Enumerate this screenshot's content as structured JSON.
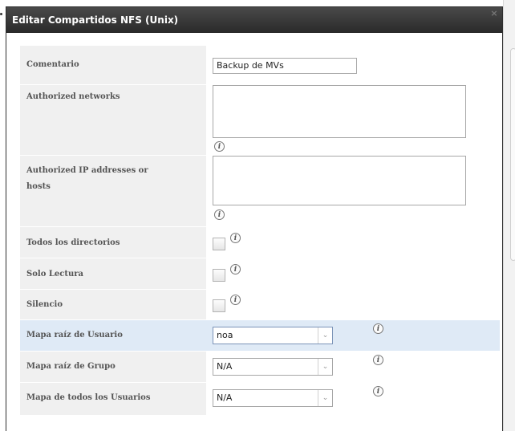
{
  "dialog": {
    "title": "Editar Compartidos NFS (Unix)",
    "close_glyph": "×"
  },
  "form": {
    "comment": {
      "label": "Comentario",
      "value": "Backup de MVs"
    },
    "authorized_networks": {
      "label": "Authorized networks",
      "value": ""
    },
    "authorized_hosts": {
      "label_line1": "Authorized IP addresses or",
      "label_line2": "hosts",
      "value": ""
    },
    "all_dirs": {
      "label": "Todos los directorios",
      "checked": false
    },
    "read_only": {
      "label": "Solo Lectura",
      "checked": false
    },
    "quiet": {
      "label": "Silencio",
      "checked": false
    },
    "maproot_user": {
      "label": "Mapa raíz de Usuario",
      "value": "noa"
    },
    "maproot_group": {
      "label": "Mapa raíz de Grupo",
      "value": "N/A"
    },
    "mapall_user": {
      "label": "Mapa de todos los Usuarios",
      "value": "N/A"
    }
  },
  "icons": {
    "info": "i",
    "chevron": "⌄"
  }
}
